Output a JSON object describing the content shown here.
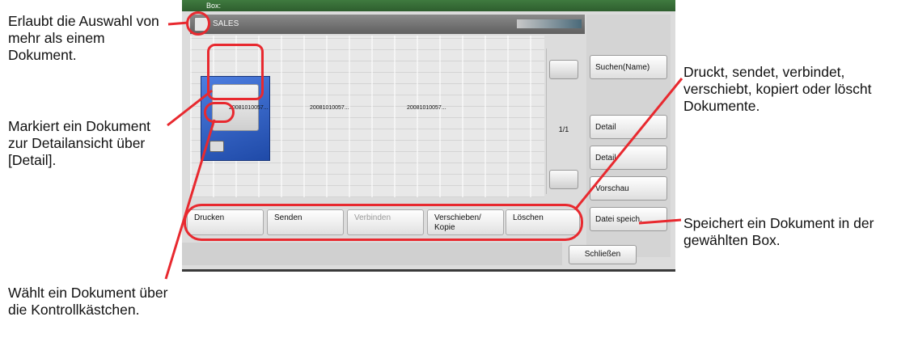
{
  "screen": {
    "title": "Box:",
    "box_name": "SALES",
    "documents": [
      {
        "name": "20081010057..."
      },
      {
        "name": "20081010057..."
      },
      {
        "name": "20081010057..."
      }
    ],
    "page_indicator": "1/1",
    "side_buttons": {
      "search": "Suchen(Name)",
      "detail_1": "Detail",
      "detail_2": "Detail",
      "preview": "Vorschau",
      "save_file": "Datei speich."
    },
    "toolbar": {
      "print": "Drucken",
      "send": "Senden",
      "join": "Verbinden",
      "move_copy": "Verschieben/ Kopie",
      "delete": "Löschen"
    },
    "close": "Schließen"
  },
  "callouts": {
    "select_multiple": "Erlaubt die Auswahl von mehr als einem Dokument.",
    "mark_detail": "Markiert ein Dokument zur Detailansicht über [Detail].",
    "checkbox_select": "Wählt ein Dokument über die Kontrollkästchen.",
    "actions": "Druckt, sendet, verbindet, verschiebt, kopiert oder löscht Dokumente.",
    "save_document": "Speichert ein Dokument in der gewählten Box."
  },
  "colors": {
    "highlight": "#e8292f",
    "title_bar": "#3f7a3f",
    "selected_tile": "#2f5fc8"
  }
}
